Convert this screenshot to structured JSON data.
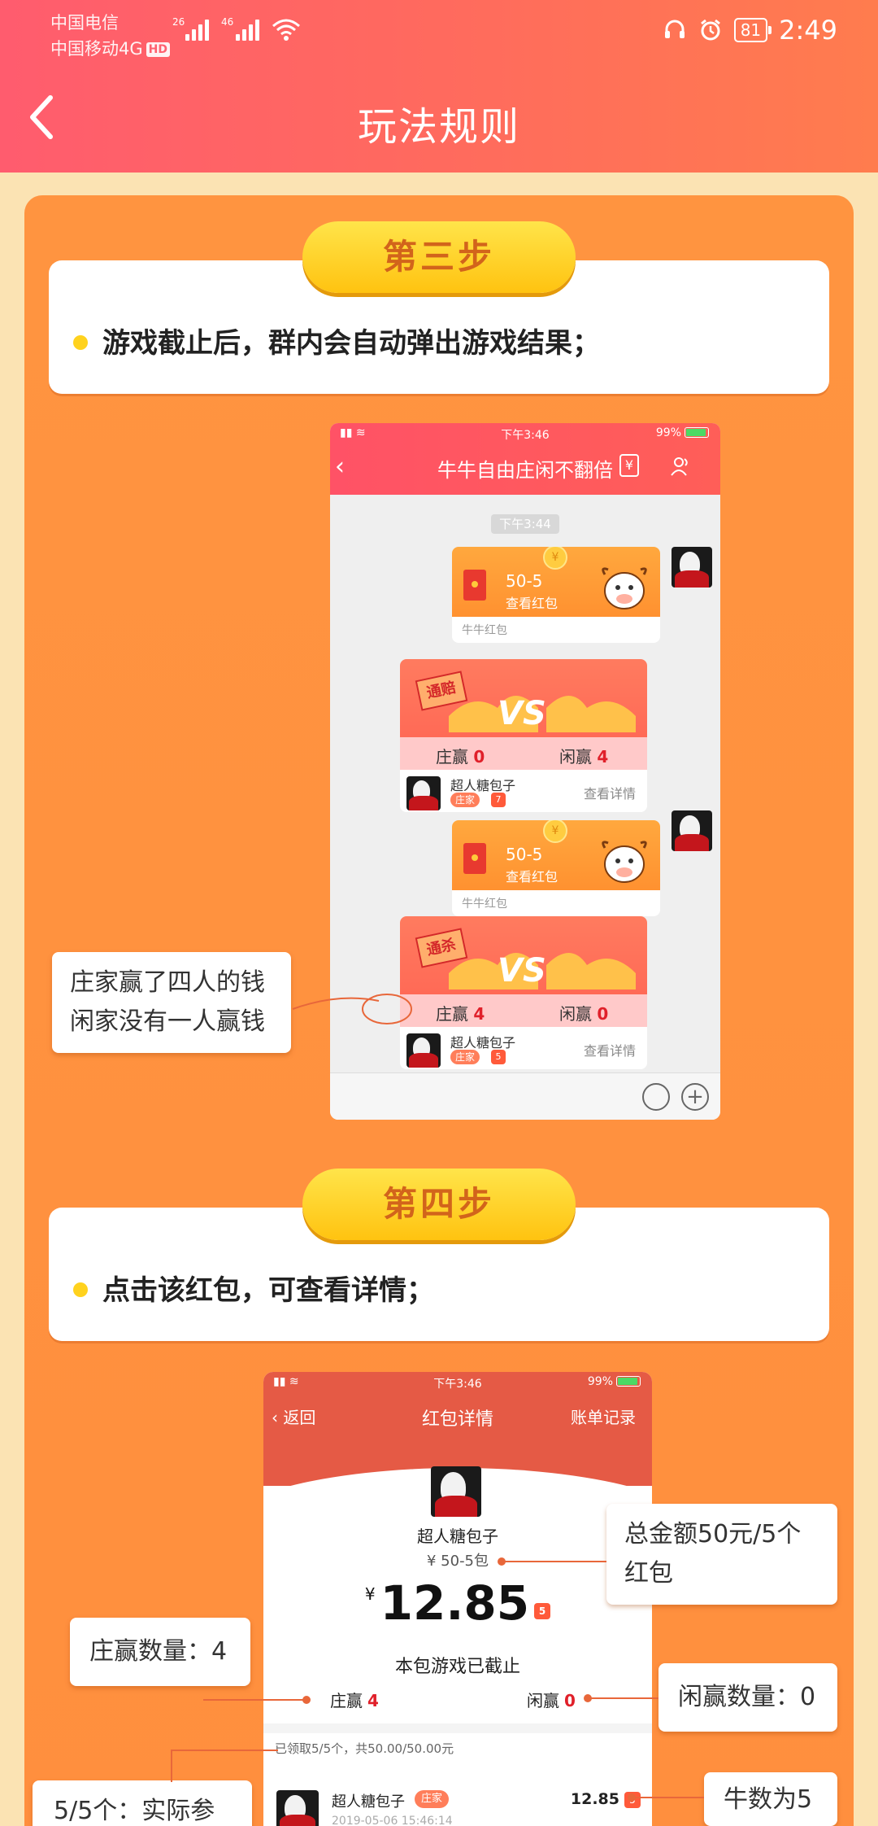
{
  "status_bar": {
    "carrier1": "中国电信",
    "carrier2": "中国移动4G",
    "hd": "HD",
    "sig1_tag": "26",
    "sig2_tag": "46",
    "battery": "81",
    "time": "2:49"
  },
  "header": {
    "title": "玩法规则"
  },
  "step3": {
    "label": "第三步",
    "text": "游戏截止后，群内会自动弹出游戏结果；"
  },
  "shot1": {
    "status_time": "下午3:46",
    "status_battery": "99%",
    "title": "牛牛自由庄闲不翻倍",
    "msg_time": "下午3:44",
    "red_packets": [
      {
        "amount": "50-5",
        "view": "查看红包",
        "footer": "牛牛红包"
      },
      {
        "amount": "50-5",
        "view": "查看红包",
        "footer": "牛牛红包"
      }
    ],
    "results": [
      {
        "stamp": "通赔",
        "banker": "庄赢",
        "banker_count": "0",
        "player": "闲赢",
        "player_count": "4",
        "name": "超人糖包子",
        "badge": "庄家",
        "cow": "7",
        "detail": "查看详情"
      },
      {
        "stamp": "通杀",
        "banker": "庄赢",
        "banker_count": "4",
        "player": "闲赢",
        "player_count": "0",
        "name": "超人糖包子",
        "badge": "庄家",
        "cow": "5",
        "detail": "查看详情"
      }
    ]
  },
  "callout1": {
    "line1": "庄家赢了四人的钱",
    "line2": "闲家没有一人赢钱"
  },
  "step4": {
    "label": "第四步",
    "text": "点击该红包，可查看详情；"
  },
  "shot2": {
    "status_time": "下午3:46",
    "status_battery": "99%",
    "back": "返回",
    "title": "红包详情",
    "bill": "账单记录",
    "name": "超人糖包子",
    "sub": "¥ 50-5包",
    "currency": "¥",
    "amount": "12.85",
    "amount_cow": "5",
    "ended": "本包游戏已截止",
    "banker_win": "庄赢",
    "banker_win_count": "4",
    "player_win": "闲赢",
    "player_win_count": "0",
    "claimed": "已领取5/5个，共50.00/50.00元",
    "row_name": "超人糖包子",
    "row_badge": "庄家",
    "row_amount": "12.85",
    "row_cow": "5",
    "row_time": "2019-05-06 15:46:14"
  },
  "callouts": {
    "total": {
      "line1": "总金额50元/5个",
      "line2": "红包"
    },
    "banker_count": "庄赢数量：4",
    "player_count": "闲赢数量：0",
    "claimed": "5/5个：实际参",
    "cow": "牛数为5"
  },
  "colors": {
    "header": "#ff5c6e",
    "panel": "#ff9440",
    "pill": "#ffc310",
    "accent": "#e0202a"
  }
}
